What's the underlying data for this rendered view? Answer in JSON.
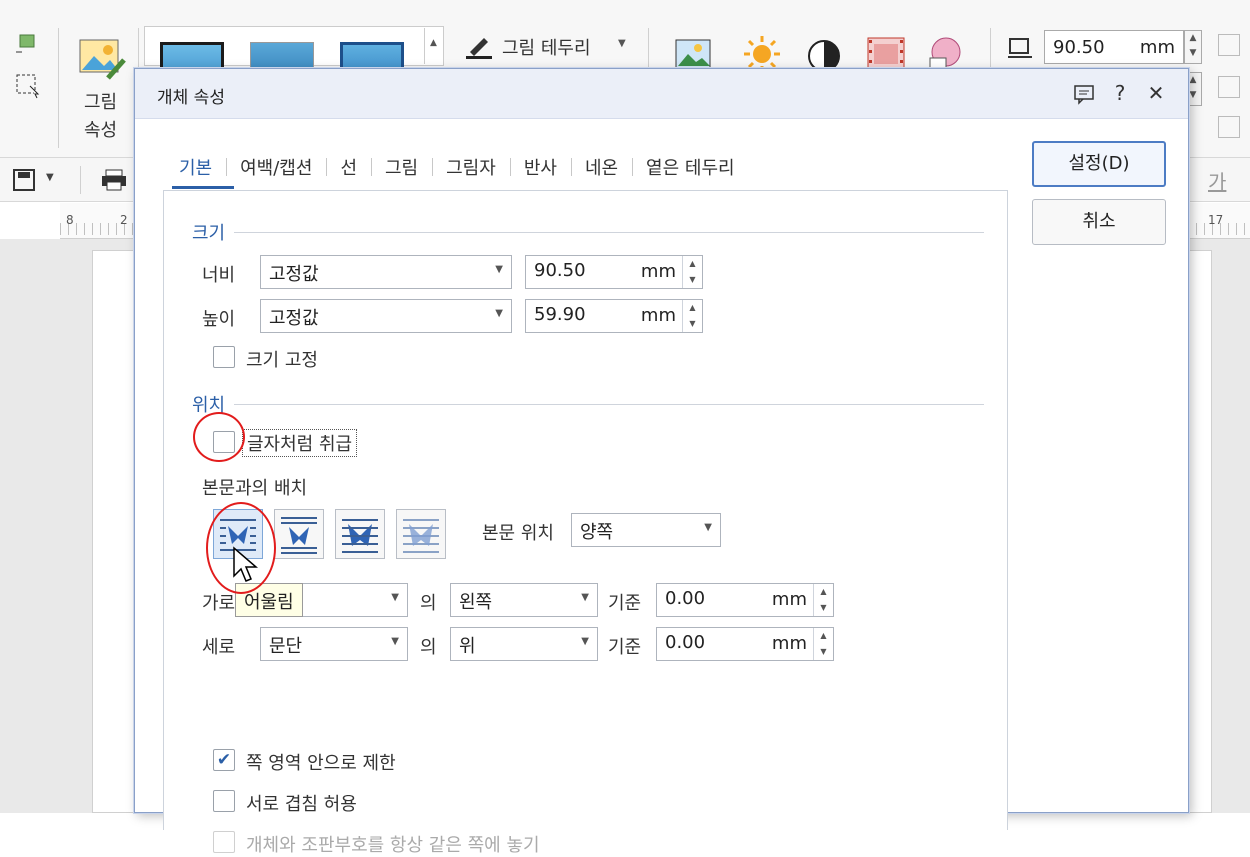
{
  "toolbar": {
    "picture_label_line1": "그림",
    "picture_label_line2": "속성",
    "border_label": "그림 테두리",
    "width_value": "90.50",
    "unit": "mm",
    "ruler_marks": [
      "8",
      "2",
      "17"
    ],
    "font_button_label": "가"
  },
  "dialog": {
    "title": "개체 속성",
    "tabs": [
      {
        "label": "기본"
      },
      {
        "label": "여백/캡션"
      },
      {
        "label": "선"
      },
      {
        "label": "그림"
      },
      {
        "label": "그림자"
      },
      {
        "label": "반사"
      },
      {
        "label": "네온"
      },
      {
        "label": "옅은 테두리"
      }
    ],
    "confirm_label": "설정(D)",
    "cancel_label": "취소",
    "size": {
      "header": "크기",
      "width_label": "너비",
      "width_mode": "고정값",
      "width_value": "90.50",
      "height_label": "높이",
      "height_mode": "고정값",
      "height_value": "59.90",
      "unit": "mm",
      "lock_label": "크기 고정",
      "lock_checked": false
    },
    "position": {
      "header": "위치",
      "treat_as_char_label": "글자처럼 취급",
      "treat_as_char_checked": false,
      "layout_label": "본문과의 배치",
      "text_position_label": "본문 위치",
      "text_position_value": "양쪽",
      "tooltip": "어울림",
      "horizontal_label": "가로",
      "horizontal_relative_value": "",
      "of_label": "의",
      "horizontal_align_value": "왼쪽",
      "base_label": "기준",
      "horizontal_offset": "0.00",
      "vertical_label": "세로",
      "vertical_relative_value": "문단",
      "vertical_align_value": "위",
      "vertical_offset": "0.00",
      "unit": "mm",
      "limit_label": "쪽 영역 안으로 제한",
      "limit_checked": true,
      "overlap_label": "서로 겹침 허용",
      "overlap_checked": false,
      "same_page_label": "개체와 조판부호를 항상 같은 쪽에 놓기",
      "same_page_checked": false
    }
  },
  "colors": {
    "accent": "#2b5fa7",
    "annotation_red": "#e21c1c",
    "tooltip_bg": "#ffffe6"
  }
}
